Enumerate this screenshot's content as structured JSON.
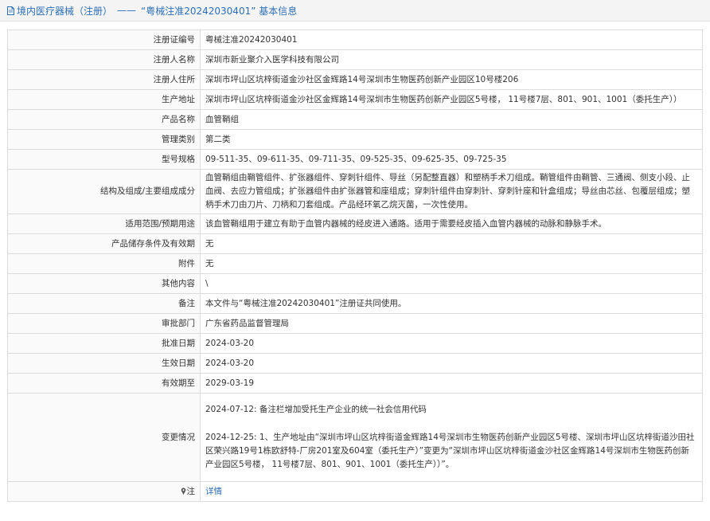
{
  "header": {
    "title": "境内医疗器械（注册）",
    "separator": "——",
    "subtitle": "“粤械注准20242030401” 基本信息"
  },
  "rows": [
    {
      "label": "注册证编号",
      "value": "粤械注准20242030401"
    },
    {
      "label": "注册人名称",
      "value": "深圳市新业聚介入医学科技有限公司"
    },
    {
      "label": "注册人住所",
      "value": "深圳市坪山区坑梓街道金沙社区金辉路14号深圳市生物医药创新产业园区10号楼206"
    },
    {
      "label": "生产地址",
      "value": "深圳市坪山区坑梓街道金沙社区金辉路14号深圳市生物医药创新产业园区5号楼， 11号楼7层、801、901、1001（委托生产））"
    },
    {
      "label": "产品名称",
      "value": "血管鞘组"
    },
    {
      "label": "管理类别",
      "value": "第二类"
    },
    {
      "label": "型号规格",
      "value": "09-511-35、09-611-35、09-711-35、09-525-35、09-625-35、09-725-35"
    },
    {
      "label": "结构及组成/主要组成成分",
      "value": "血管鞘组由鞘管组件、扩张器组件、穿刺针组件、导丝（另配整直器）和塑柄手术刀组成。鞘管组件由鞘管、三通阀、侧支小段、止血阀、去应力管组成；扩张器组件由扩张器管和座组成；穿刺针组件由穿刺针、穿刺针座和针盒组成；导丝由芯丝、包覆层组成；塑柄手术刀由刀片、刀柄和刀套组成。产品经环氧乙烷灭菌，一次性使用。"
    },
    {
      "label": "适用范围/预期用途",
      "value": "该血管鞘组用于建立有助于血管内器械的经皮进入通路。适用于需要经皮插入血管内器械的动脉和静脉手术。"
    },
    {
      "label": "产品储存条件及有效期",
      "value": "无"
    },
    {
      "label": "附件",
      "value": "无"
    },
    {
      "label": "其他内容",
      "value": "\\"
    },
    {
      "label": "备注",
      "value": "本文件与“粤械注准20242030401”注册证共同使用。"
    },
    {
      "label": "审批部门",
      "value": "广东省药品监督管理局"
    },
    {
      "label": "批准日期",
      "value": "2024-03-20"
    },
    {
      "label": "生效日期",
      "value": "2024-03-20"
    },
    {
      "label": "有效期至",
      "value": "2029-03-19"
    }
  ],
  "changes": {
    "label": "变更情况",
    "entry1": "2024-07-12: 备注栏增加受托生产企业的统一社会信用代码",
    "entry2": "2024-12-25: 1、生产地址由“深圳市坪山区坑梓街道金辉路14号深圳市生物医药创新产业园区5号楼、深圳市坪山区坑梓街道沙田社区荣兴路19号1栋欧舒特-厂房201室及604室（委托生产）”变更为“深圳市坪山区坑梓街道金沙社区金辉路14号深圳市生物医药创新产业园区5号楼， 11号楼7层、801、901、1001（委托生产））”。"
  },
  "note": {
    "label": "注",
    "link_text": "详情"
  }
}
